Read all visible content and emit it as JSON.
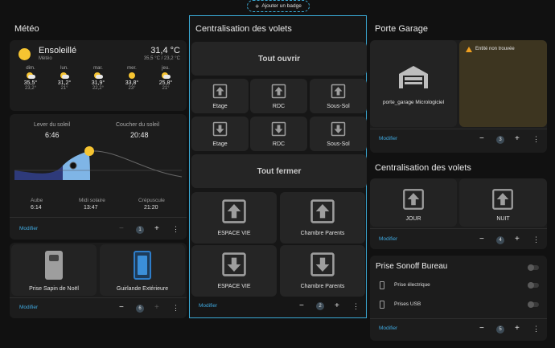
{
  "badge": {
    "label": "Ajouter un badge"
  },
  "meteo": {
    "title": "Météo",
    "condition": "Ensoleillé",
    "source": "Météo",
    "temp": "31,4 °C",
    "range": "35,5 °C / 23,2 °C",
    "forecast": [
      {
        "day": "dim.",
        "hi": "35,5°",
        "lo": "23,2°",
        "icon": "sun-cloud-icon"
      },
      {
        "day": "lun.",
        "hi": "31,2°",
        "lo": "21°",
        "icon": "cloud-sun-icon"
      },
      {
        "day": "mar.",
        "hi": "31,9°",
        "lo": "22,2°",
        "icon": "cloud-sun-icon"
      },
      {
        "day": "mer.",
        "hi": "33,8°",
        "lo": "23°",
        "icon": "sun-icon"
      },
      {
        "day": "jeu.",
        "hi": "25,8°",
        "lo": "21°",
        "icon": "cloud-sun-icon"
      }
    ],
    "sun": {
      "rise_label": "Lever du soleil",
      "rise": "6:46",
      "set_label": "Coucher du soleil",
      "set": "20:48",
      "dawn_label": "Aube",
      "dawn": "6:14",
      "noon_label": "Midi solaire",
      "noon": "13:47",
      "dusk_label": "Crépuscule",
      "dusk": "21:20"
    },
    "edit": "Modifier",
    "count": "1"
  },
  "lights": {
    "items": [
      {
        "label": "Prise Sapin de Noël"
      },
      {
        "label": "Guirlande Extérieure"
      }
    ],
    "edit": "Modifier",
    "count": "6"
  },
  "volets": {
    "title": "Centralisation des volets",
    "open_all": "Tout ouvrir",
    "close_all": "Tout fermer",
    "up": [
      {
        "label": "Etage"
      },
      {
        "label": "RDC"
      },
      {
        "label": "Sous-Sol"
      }
    ],
    "down": [
      {
        "label": "Etage"
      },
      {
        "label": "RDC"
      },
      {
        "label": "Sous-Sol"
      }
    ],
    "big_up": [
      {
        "label": "ESPACE VIE"
      },
      {
        "label": "Chambre Parents"
      }
    ],
    "big_down": [
      {
        "label": "ESPACE VIE"
      },
      {
        "label": "Chambre Parents"
      }
    ],
    "edit": "Modifier",
    "count": "2"
  },
  "garage": {
    "title": "Porte Garage",
    "entity": "porte_garage Micrologiciel",
    "warning": "Entité non trouvée",
    "edit": "Modifier",
    "count": "3"
  },
  "volets2": {
    "title": "Centralisation des volets",
    "items": [
      {
        "label": "JOUR"
      },
      {
        "label": "NUIT"
      }
    ],
    "edit": "Modifier",
    "count": "4"
  },
  "sonoff": {
    "title": "Prise Sonoff Bureau",
    "items": [
      {
        "label": "Prise électrique"
      },
      {
        "label": "Prises USB"
      }
    ],
    "edit": "Modifier",
    "count": "5"
  },
  "colors": {
    "accent": "#3fa9e0",
    "warning_bg": "#3d3520",
    "warning_icon": "#f0a020"
  }
}
